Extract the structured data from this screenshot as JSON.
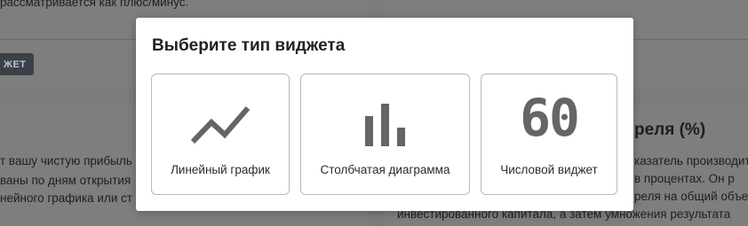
{
  "background": {
    "top_left_text": "рассматривается как плюс/минус.",
    "button_label": "ЖЕТ",
    "right_heading": "реля (%)",
    "left_lines": [
      "т вашу чистую прибыль",
      "ваны по дням открытия",
      "нейного графика или ст"
    ],
    "right_lines": [
      "казатель производит",
      "в процентах. Он р",
      "реля на общий объем",
      "инвестированного капитала, а затем умножения результата"
    ]
  },
  "modal": {
    "title": "Выберите тип виджета",
    "options": [
      {
        "label": "Линейный график",
        "icon": "line-chart-icon"
      },
      {
        "label": "Столбчатая диаграмма",
        "icon": "bar-chart-icon"
      },
      {
        "label": "Числовой виджет",
        "icon": "number-icon",
        "glyph": "60"
      }
    ]
  },
  "colors": {
    "overlay_bg": "#7b7b7b",
    "icon": "#656565",
    "option_border": "#b9b9b9"
  }
}
